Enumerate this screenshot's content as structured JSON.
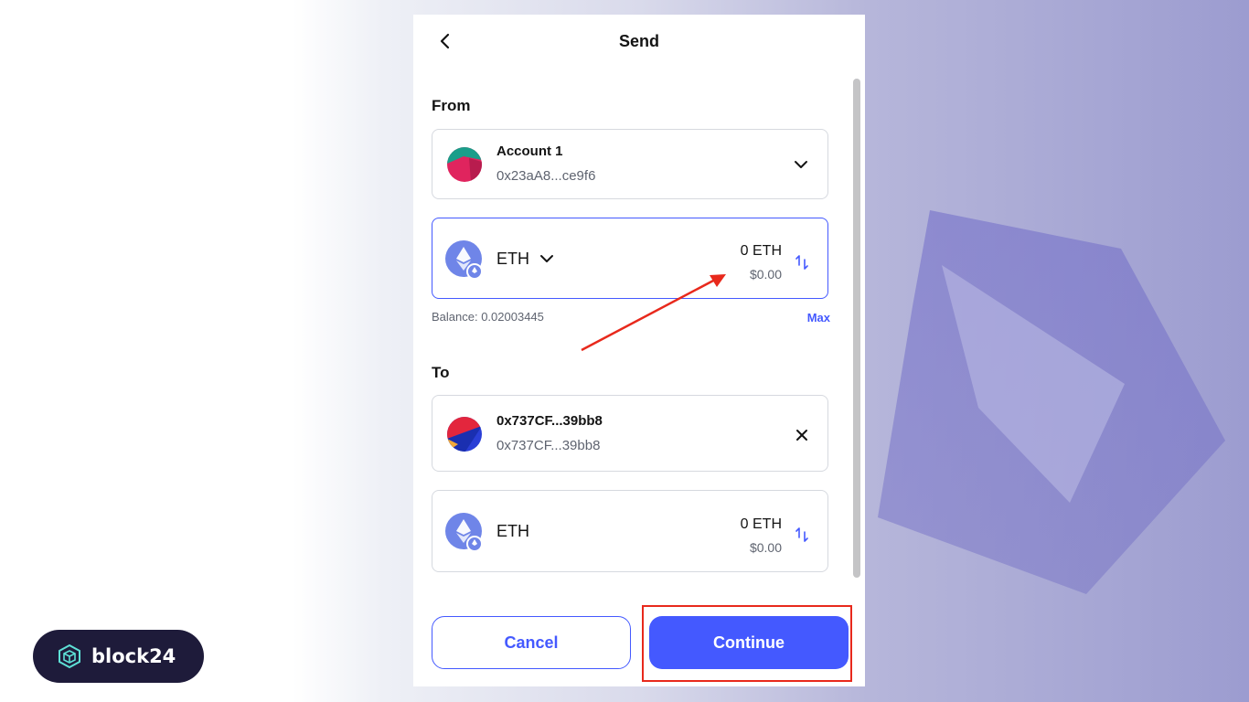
{
  "brand": {
    "name": "block24"
  },
  "header": {
    "title": "Send"
  },
  "from": {
    "label": "From",
    "account": {
      "name": "Account 1",
      "address": "0x23aA8...ce9f6"
    },
    "token": {
      "symbol": "ETH",
      "amount": "0 ETH",
      "fiat": "$0.00"
    },
    "balance": "Balance: 0.02003445",
    "max_label": "Max"
  },
  "to": {
    "label": "To",
    "recipient": {
      "name": "0x737CF...39bb8",
      "address": "0x737CF...39bb8"
    },
    "token": {
      "symbol": "ETH",
      "amount": "0 ETH",
      "fiat": "$0.00"
    }
  },
  "actions": {
    "cancel_label": "Cancel",
    "continue_label": "Continue"
  },
  "colors": {
    "accent": "#4459ff",
    "annotation": "#e8291c",
    "logo_bg": "#1e1b3a"
  },
  "icons": [
    "back-arrow-icon",
    "chevron-down-icon",
    "close-icon",
    "swap-icon",
    "eth-icon"
  ]
}
